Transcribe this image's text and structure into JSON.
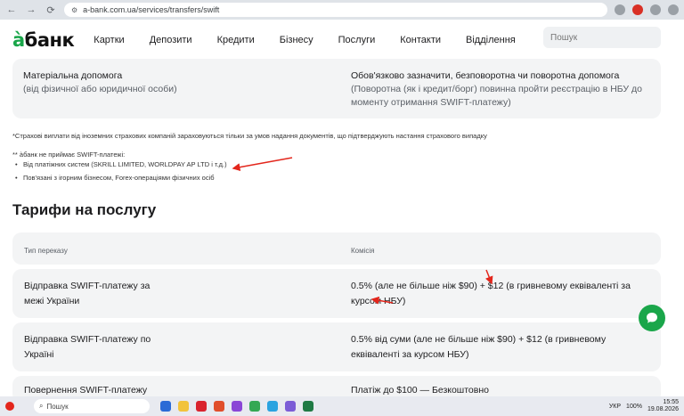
{
  "browser": {
    "url": "a-bank.com.ua/services/transfers/swift"
  },
  "header": {
    "logo_accent": "à",
    "logo_rest": "банк",
    "nav": [
      "Картки",
      "Депозити",
      "Кредити",
      "Бізнесу",
      "Послуги",
      "Контакти",
      "Відділення"
    ],
    "search_placeholder": "Пошук"
  },
  "card": {
    "left_title": "Матеріальна допомога",
    "left_sub": "(від фізичної або юридичної особи)",
    "right_title": "Обов'язково зазначити, безповоротна чи поворотна допомога",
    "right_sub": "(Поворотна (як і кредит/борг) повинна пройти реєстрацію в НБУ до моменту отримання SWIFT-платежу)"
  },
  "notes": {
    "insurance": "*Страхові виплати від іноземних страхових компаній зараховуються тільки за умов надання документів, що підтверджують настання страхового випадку",
    "not_accepts": "** àбанк не приймає SWIFT-платежі:",
    "bullets": [
      "Від платіжних систем (SKRILL LIMITED, WORLDPAY AP LTD і т.д.)",
      "Пов'язані з ігорним бізнесом, Forex-операціями фізичних осіб"
    ]
  },
  "tariffs": {
    "heading": "Тарифи на послугу",
    "col_type": "Тип переказу",
    "col_fee": "Комісія",
    "rows": [
      {
        "type": "Відправка SWIFT-платежу за межі України",
        "fee": "0.5% (але не більше ніж $90) + $12 (в гривневому еквіваленті за курсом НБУ)"
      },
      {
        "type": "Відправка SWIFT-платежу по Україні",
        "fee": "0.5% від суми (але не більше ніж $90) + $12 (в гривневому еквіваленті за курсом НБУ)"
      },
      {
        "type": "Повернення SWIFT-платежу",
        "fee": "Платіж до $100 — Безкоштовно"
      }
    ]
  },
  "taskbar": {
    "search": "Пошук",
    "lang": "УКР",
    "battery": "100%",
    "time": "15:55",
    "date": "19.08.2026"
  },
  "colors": {
    "brand": "#1aa64a",
    "arrow": "#e3261c"
  }
}
